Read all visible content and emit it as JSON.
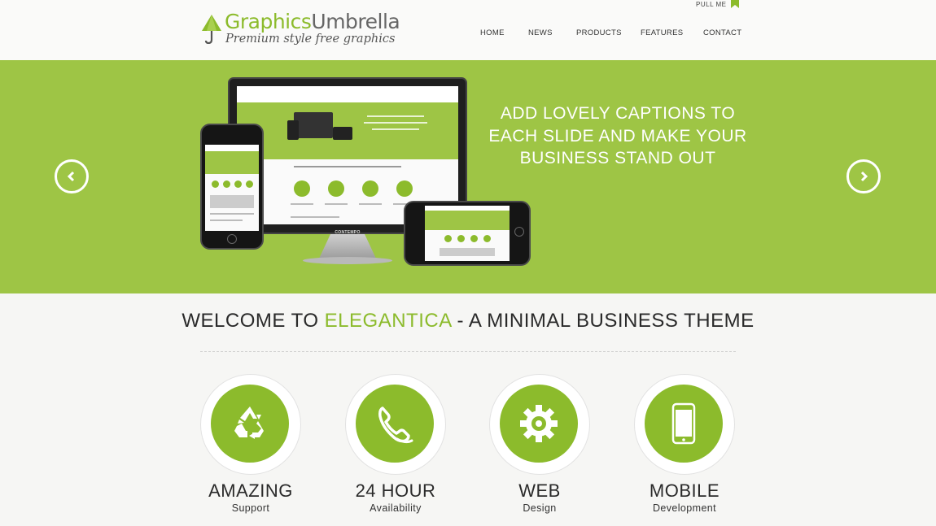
{
  "header": {
    "logo": {
      "title_part1": "Graphics",
      "title_part2": "Umbrella",
      "tagline": "Premium style free graphics"
    },
    "pull_me": "PULL ME",
    "nav": [
      {
        "label": "HOME"
      },
      {
        "label": "NEWS"
      },
      {
        "label": "PRODUCTS"
      },
      {
        "label": "FEATURES"
      },
      {
        "label": "CONTACT"
      }
    ]
  },
  "hero": {
    "caption_lines": [
      "ADD LOVELY CAPTIONS TO",
      "EACH SLIDE AND MAKE YOUR",
      "BUSINESS STAND OUT"
    ],
    "monitor_brand": "CONTEMPO",
    "prev_icon": "chevron-left-icon",
    "next_icon": "chevron-right-icon"
  },
  "welcome": {
    "prefix": "WELCOME TO ",
    "accent": "ELEGANTICA",
    "suffix": " - A MINIMAL BUSINESS THEME"
  },
  "features": [
    {
      "title": "AMAZING",
      "subtitle": "Support",
      "icon": "recycle-icon"
    },
    {
      "title": "24 HOUR",
      "subtitle": "Availability",
      "icon": "phone-handset-icon"
    },
    {
      "title": "WEB",
      "subtitle": "Design",
      "icon": "gear-icon"
    },
    {
      "title": "MOBILE",
      "subtitle": "Development",
      "icon": "mobile-phone-icon"
    }
  ],
  "colors": {
    "accent": "#8cbb2c",
    "hero_background": "#9ec545",
    "page_background": "#f6f6f4",
    "text_dark": "#2a2a2a"
  }
}
